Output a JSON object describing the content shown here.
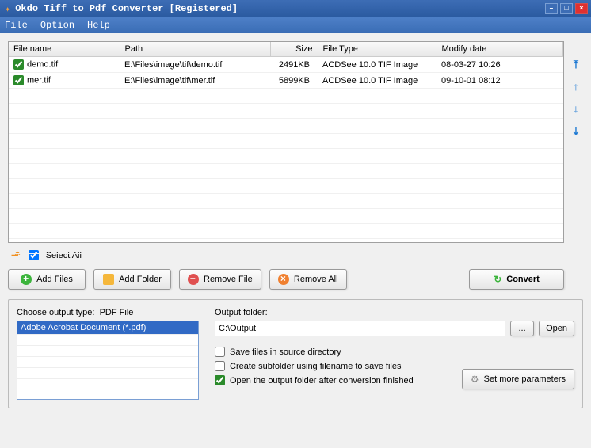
{
  "window": {
    "title": "Okdo Tiff to Pdf Converter [Registered]"
  },
  "menu": {
    "file": "File",
    "option": "Option",
    "help": "Help"
  },
  "columns": {
    "filename": "File name",
    "path": "Path",
    "size": "Size",
    "filetype": "File Type",
    "modifydate": "Modify date"
  },
  "files": [
    {
      "checked": true,
      "name": "demo.tif",
      "path": "E:\\Files\\image\\tif\\demo.tif",
      "size": "2491KB",
      "type": "ACDSee 10.0 TIF Image",
      "date": "08-03-27 10:26"
    },
    {
      "checked": true,
      "name": "mer.tif",
      "path": "E:\\Files\\image\\tif\\mer.tif",
      "size": "5899KB",
      "type": "ACDSee 10.0 TIF Image",
      "date": "09-10-01 08:12"
    }
  ],
  "selectall": {
    "label": "Select All",
    "checked": true
  },
  "toolbar": {
    "addfiles": "Add Files",
    "addfolder": "Add Folder",
    "removefile": "Remove File",
    "removeall": "Remove All",
    "convert": "Convert"
  },
  "output_type": {
    "label": "Choose output type:",
    "current": "PDF File",
    "options": [
      "Adobe Acrobat Document (*.pdf)"
    ]
  },
  "output": {
    "label": "Output folder:",
    "value": "C:\\Output",
    "browse": "...",
    "open": "Open",
    "save_source": {
      "checked": false,
      "label": "Save files in source directory"
    },
    "create_sub": {
      "checked": false,
      "label": "Create subfolder using filename to save files"
    },
    "open_after": {
      "checked": true,
      "label": "Open the output folder after conversion finished"
    },
    "more_params": "Set more parameters"
  }
}
